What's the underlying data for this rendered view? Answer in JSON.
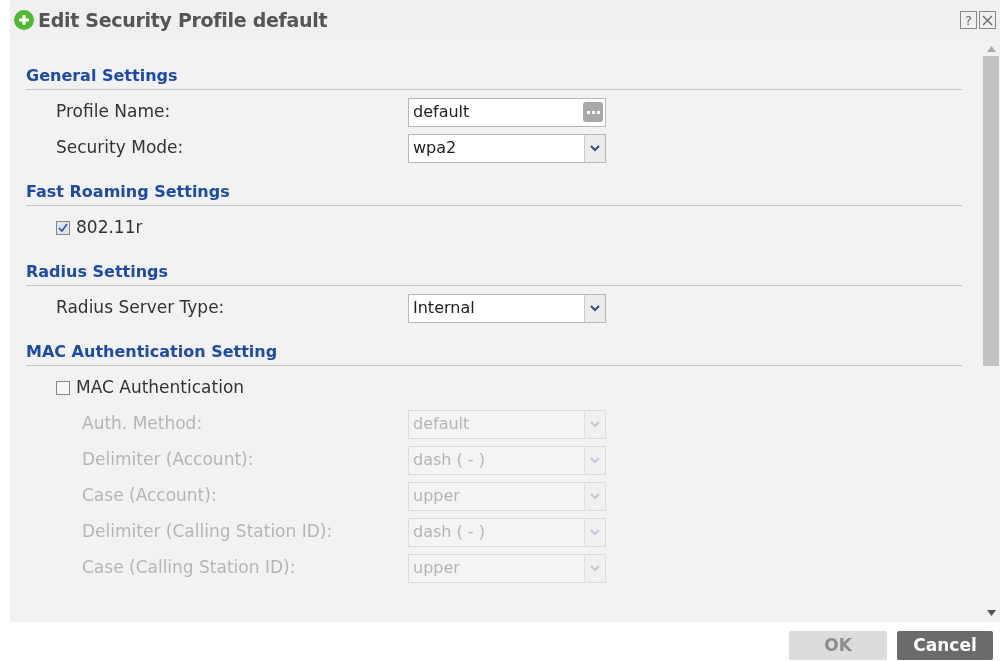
{
  "window": {
    "title": "Edit Security Profile default",
    "help": "?"
  },
  "sections": [
    {
      "heading": "General Settings",
      "rows": [
        {
          "kind": "text",
          "label": "Profile Name:",
          "value": "default",
          "disabled": false
        },
        {
          "kind": "select",
          "label": "Security Mode:",
          "value": "wpa2",
          "disabled": false
        }
      ]
    },
    {
      "heading": "Fast Roaming Settings",
      "rows": [
        {
          "kind": "checkbox",
          "label": "802.11r",
          "checked": true,
          "disabled": false
        }
      ]
    },
    {
      "heading": "Radius Settings",
      "rows": [
        {
          "kind": "select",
          "label": "Radius Server Type:",
          "value": "Internal",
          "disabled": false
        }
      ]
    },
    {
      "heading": "MAC Authentication Setting",
      "rows": [
        {
          "kind": "checkbox",
          "label": "MAC Authentication",
          "checked": false,
          "disabled": false
        },
        {
          "kind": "select",
          "label": "Auth. Method:",
          "value": "default",
          "disabled": true
        },
        {
          "kind": "select",
          "label": "Delimiter (Account):",
          "value": "dash ( - )",
          "disabled": true
        },
        {
          "kind": "select",
          "label": "Case (Account):",
          "value": "upper",
          "disabled": true
        },
        {
          "kind": "select",
          "label": "Delimiter (Calling Station ID):",
          "value": "dash ( - )",
          "disabled": true
        },
        {
          "kind": "select",
          "label": "Case (Calling Station ID):",
          "value": "upper",
          "disabled": true
        }
      ]
    }
  ],
  "buttons": [
    {
      "label": "OK",
      "disabled": true
    },
    {
      "label": "Cancel",
      "disabled": false
    }
  ]
}
